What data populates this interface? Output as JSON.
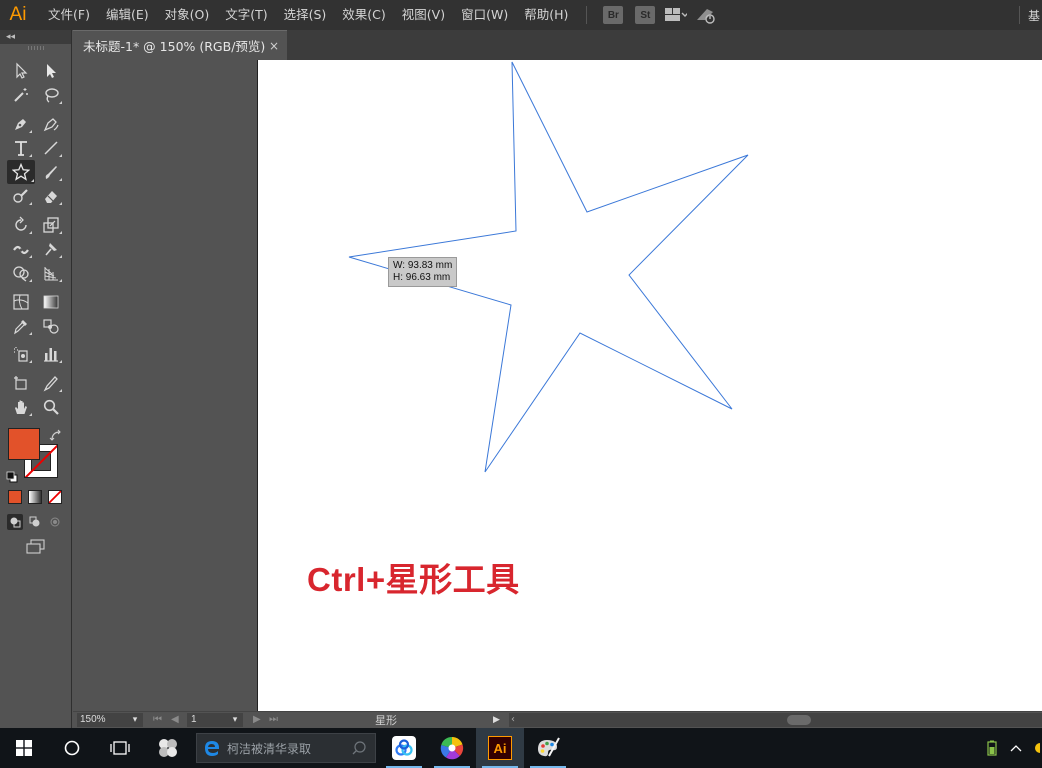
{
  "app": {
    "logo_text": "Ai"
  },
  "menubar": {
    "items": [
      "文件(F)",
      "编辑(E)",
      "对象(O)",
      "文字(T)",
      "选择(S)",
      "效果(C)",
      "视图(V)",
      "窗口(W)",
      "帮助(H)"
    ],
    "bridge_label": "Br",
    "stock_label": "St",
    "workspace_label": "基"
  },
  "toolbar": {
    "collapse_label": "◂◂",
    "tools": [
      "selection-tool-icon",
      "direct-selection-tool-icon",
      "magic-wand-tool-icon",
      "lasso-tool-icon",
      "pen-tool-icon",
      "curvature-tool-icon",
      "type-tool-icon",
      "line-segment-tool-icon",
      "star-tool-icon",
      "paintbrush-tool-icon",
      "shaper-tool-icon",
      "eraser-tool-icon",
      "rotate-tool-icon",
      "scale-tool-icon",
      "width-tool-icon",
      "puppet-warp-tool-icon",
      "shape-builder-tool-icon",
      "perspective-grid-tool-icon",
      "mesh-tool-icon",
      "gradient-tool-icon",
      "eyedropper-tool-icon",
      "blend-tool-icon",
      "symbol-sprayer-tool-icon",
      "column-graph-tool-icon",
      "artboard-tool-icon",
      "slice-tool-icon",
      "hand-tool-icon",
      "zoom-tool-icon"
    ],
    "active_tool": "star-tool-icon",
    "fill_color": "#e2522a",
    "stroke_color": "none"
  },
  "document": {
    "tab_title": "未标题-1* @ 150% (RGB/预览)",
    "close_label": "×",
    "size_tooltip": {
      "width": "W: 93.83 mm",
      "height": "H: 96.63 mm"
    },
    "star_stroke_color": "#3b78d8",
    "caption": "Ctrl+星形工具",
    "caption_color": "#d8262e"
  },
  "statusbar": {
    "zoom": "150%",
    "page": "1",
    "tool_name": "星形"
  },
  "taskbar": {
    "search_placeholder": "柯洁被清华录取",
    "apps": [
      "baidu-netdisk-icon",
      "color-wheel-app-icon",
      "illustrator-icon",
      "paint-palette-app-icon"
    ],
    "active_app": "illustrator-icon",
    "illustrator_label": "Ai"
  }
}
